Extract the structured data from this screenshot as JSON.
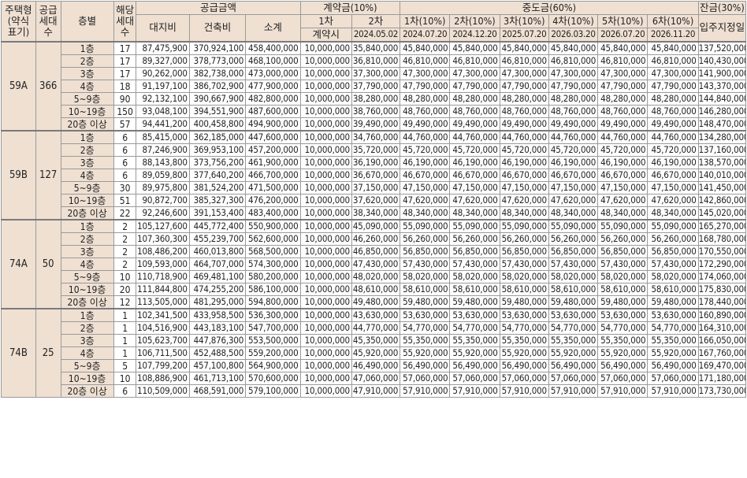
{
  "header": {
    "type": "주택형\n(약식\n표기)",
    "supply_households": "공급\n세대\n수",
    "floor": "층별",
    "units": "해당\n세대\n수",
    "supply_price": "공급금액",
    "land": "대지비",
    "building": "건축비",
    "subtotal": "소계",
    "contract": "계약금(10%)",
    "contract_1": "1차",
    "contract_2": "2차",
    "contract_1_date": "계약시",
    "contract_2_date": "2024.05.02",
    "middle": "중도금(60%)",
    "middle_installments": [
      "1차(10%)",
      "2차(10%)",
      "3차(10%)",
      "4차(10%)",
      "5차(10%)",
      "6차(10%)"
    ],
    "middle_dates": [
      "2024.07.20",
      "2024.12.20",
      "2025.07.20",
      "2026.03.20",
      "2026.07.20",
      "2026.11.20"
    ],
    "balance": "잔금(30%)",
    "balance_date": "입주지정일"
  },
  "groups": [
    {
      "type": "59A",
      "supply": "366",
      "rows": [
        {
          "floor": "1층",
          "units": "17",
          "land": "87,475,900",
          "building": "370,924,100",
          "subtotal": "458,400,000",
          "c1": "10,000,000",
          "c2": "35,840,000",
          "mid": "45,840,000",
          "balance": "137,520,000"
        },
        {
          "floor": "2층",
          "units": "17",
          "land": "89,327,000",
          "building": "378,773,000",
          "subtotal": "468,100,000",
          "c1": "10,000,000",
          "c2": "36,810,000",
          "mid": "46,810,000",
          "balance": "140,430,000"
        },
        {
          "floor": "3층",
          "units": "17",
          "land": "90,262,000",
          "building": "382,738,000",
          "subtotal": "473,000,000",
          "c1": "10,000,000",
          "c2": "37,300,000",
          "mid": "47,300,000",
          "balance": "141,900,000"
        },
        {
          "floor": "4층",
          "units": "18",
          "land": "91,197,100",
          "building": "386,702,900",
          "subtotal": "477,900,000",
          "c1": "10,000,000",
          "c2": "37,790,000",
          "mid": "47,790,000",
          "balance": "143,370,000"
        },
        {
          "floor": "5~9층",
          "units": "90",
          "land": "92,132,100",
          "building": "390,667,900",
          "subtotal": "482,800,000",
          "c1": "10,000,000",
          "c2": "38,280,000",
          "mid": "48,280,000",
          "balance": "144,840,000"
        },
        {
          "floor": "10~19층",
          "units": "150",
          "land": "93,048,100",
          "building": "394,551,900",
          "subtotal": "487,600,000",
          "c1": "10,000,000",
          "c2": "38,760,000",
          "mid": "48,760,000",
          "balance": "146,280,000"
        },
        {
          "floor": "20층 이상",
          "units": "57",
          "land": "94,441,200",
          "building": "400,458,800",
          "subtotal": "494,900,000",
          "c1": "10,000,000",
          "c2": "39,490,000",
          "mid": "49,490,000",
          "balance": "148,470,000"
        }
      ]
    },
    {
      "type": "59B",
      "supply": "127",
      "rows": [
        {
          "floor": "1층",
          "units": "6",
          "land": "85,415,000",
          "building": "362,185,000",
          "subtotal": "447,600,000",
          "c1": "10,000,000",
          "c2": "34,760,000",
          "mid": "44,760,000",
          "balance": "134,280,000"
        },
        {
          "floor": "2층",
          "units": "6",
          "land": "87,246,900",
          "building": "369,953,100",
          "subtotal": "457,200,000",
          "c1": "10,000,000",
          "c2": "35,720,000",
          "mid": "45,720,000",
          "balance": "137,160,000"
        },
        {
          "floor": "3층",
          "units": "6",
          "land": "88,143,800",
          "building": "373,756,200",
          "subtotal": "461,900,000",
          "c1": "10,000,000",
          "c2": "36,190,000",
          "mid": "46,190,000",
          "balance": "138,570,000"
        },
        {
          "floor": "4층",
          "units": "6",
          "land": "89,059,800",
          "building": "377,640,200",
          "subtotal": "466,700,000",
          "c1": "10,000,000",
          "c2": "36,670,000",
          "mid": "46,670,000",
          "balance": "140,010,000"
        },
        {
          "floor": "5~9층",
          "units": "30",
          "land": "89,975,800",
          "building": "381,524,200",
          "subtotal": "471,500,000",
          "c1": "10,000,000",
          "c2": "37,150,000",
          "mid": "47,150,000",
          "balance": "141,450,000"
        },
        {
          "floor": "10~19층",
          "units": "51",
          "land": "90,872,700",
          "building": "385,327,300",
          "subtotal": "476,200,000",
          "c1": "10,000,000",
          "c2": "37,620,000",
          "mid": "47,620,000",
          "balance": "142,860,000"
        },
        {
          "floor": "20층 이상",
          "units": "22",
          "land": "92,246,600",
          "building": "391,153,400",
          "subtotal": "483,400,000",
          "c1": "10,000,000",
          "c2": "38,340,000",
          "mid": "48,340,000",
          "balance": "145,020,000"
        }
      ]
    },
    {
      "type": "74A",
      "supply": "50",
      "rows": [
        {
          "floor": "1층",
          "units": "2",
          "land": "105,127,600",
          "building": "445,772,400",
          "subtotal": "550,900,000",
          "c1": "10,000,000",
          "c2": "45,090,000",
          "mid": "55,090,000",
          "balance": "165,270,000"
        },
        {
          "floor": "2층",
          "units": "2",
          "land": "107,360,300",
          "building": "455,239,700",
          "subtotal": "562,600,000",
          "c1": "10,000,000",
          "c2": "46,260,000",
          "mid": "56,260,000",
          "balance": "168,780,000"
        },
        {
          "floor": "3층",
          "units": "2",
          "land": "108,486,200",
          "building": "460,013,800",
          "subtotal": "568,500,000",
          "c1": "10,000,000",
          "c2": "46,850,000",
          "mid": "56,850,000",
          "balance": "170,550,000"
        },
        {
          "floor": "4층",
          "units": "2",
          "land": "109,593,000",
          "building": "464,707,000",
          "subtotal": "574,300,000",
          "c1": "10,000,000",
          "c2": "47,430,000",
          "mid": "57,430,000",
          "balance": "172,290,000"
        },
        {
          "floor": "5~9층",
          "units": "10",
          "land": "110,718,900",
          "building": "469,481,100",
          "subtotal": "580,200,000",
          "c1": "10,000,000",
          "c2": "48,020,000",
          "mid": "58,020,000",
          "balance": "174,060,000"
        },
        {
          "floor": "10~19층",
          "units": "20",
          "land": "111,844,800",
          "building": "474,255,200",
          "subtotal": "586,100,000",
          "c1": "10,000,000",
          "c2": "48,610,000",
          "mid": "58,610,000",
          "balance": "175,830,000"
        },
        {
          "floor": "20층 이상",
          "units": "12",
          "land": "113,505,000",
          "building": "481,295,000",
          "subtotal": "594,800,000",
          "c1": "10,000,000",
          "c2": "49,480,000",
          "mid": "59,480,000",
          "balance": "178,440,000"
        }
      ]
    },
    {
      "type": "74B",
      "supply": "25",
      "rows": [
        {
          "floor": "1층",
          "units": "1",
          "land": "102,341,500",
          "building": "433,958,500",
          "subtotal": "536,300,000",
          "c1": "10,000,000",
          "c2": "43,630,000",
          "mid": "53,630,000",
          "balance": "160,890,000"
        },
        {
          "floor": "2층",
          "units": "1",
          "land": "104,516,900",
          "building": "443,183,100",
          "subtotal": "547,700,000",
          "c1": "10,000,000",
          "c2": "44,770,000",
          "mid": "54,770,000",
          "balance": "164,310,000"
        },
        {
          "floor": "3층",
          "units": "1",
          "land": "105,623,700",
          "building": "447,876,300",
          "subtotal": "553,500,000",
          "c1": "10,000,000",
          "c2": "45,350,000",
          "mid": "55,350,000",
          "balance": "166,050,000"
        },
        {
          "floor": "4층",
          "units": "1",
          "land": "106,711,500",
          "building": "452,488,500",
          "subtotal": "559,200,000",
          "c1": "10,000,000",
          "c2": "45,920,000",
          "mid": "55,920,000",
          "balance": "167,760,000"
        },
        {
          "floor": "5~9층",
          "units": "5",
          "land": "107,799,200",
          "building": "457,100,800",
          "subtotal": "564,900,000",
          "c1": "10,000,000",
          "c2": "46,490,000",
          "mid": "56,490,000",
          "balance": "169,470,000"
        },
        {
          "floor": "10~19층",
          "units": "10",
          "land": "108,886,900",
          "building": "461,713,100",
          "subtotal": "570,600,000",
          "c1": "10,000,000",
          "c2": "47,060,000",
          "mid": "57,060,000",
          "balance": "171,180,000"
        },
        {
          "floor": "20층 이상",
          "units": "6",
          "land": "110,509,000",
          "building": "468,591,000",
          "subtotal": "579,100,000",
          "c1": "10,000,000",
          "c2": "47,910,000",
          "mid": "57,910,000",
          "balance": "173,730,000"
        }
      ]
    }
  ]
}
